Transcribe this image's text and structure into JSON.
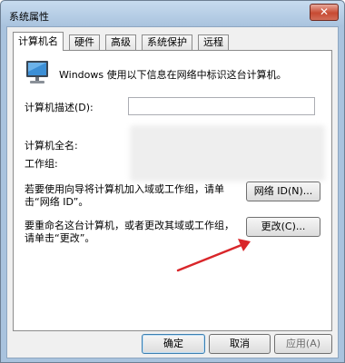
{
  "window": {
    "title": "系统属性",
    "close_label": "✕"
  },
  "tabs": [
    {
      "label": "计算机名",
      "active": true
    },
    {
      "label": "硬件",
      "active": false
    },
    {
      "label": "高级",
      "active": false
    },
    {
      "label": "系统保护",
      "active": false
    },
    {
      "label": "远程",
      "active": false
    }
  ],
  "panel": {
    "intro": "Windows 使用以下信息在网络中标识这台计算机。",
    "description_label": "计算机描述(D):",
    "description_value": "",
    "full_name_label": "计算机全名:",
    "workgroup_label": "工作组:",
    "network_text_line1": "若要使用向导将计算机加入域或工作组，请单",
    "network_text_line2": "击“网络 ID”。",
    "network_id_button": "网络 ID(N)...",
    "rename_text_line1": "要重命名这台计算机，或者更改其域或工作组，",
    "rename_text_line2": "请单击“更改”。",
    "change_button": "更改(C)..."
  },
  "footer": {
    "ok": "确定",
    "cancel": "取消",
    "apply": "应用(A)"
  },
  "colors": {
    "arrow": "#d9262a",
    "title_bar": "#a9c3de"
  },
  "icons": {
    "computer": "computer-icon",
    "close": "close-icon"
  }
}
